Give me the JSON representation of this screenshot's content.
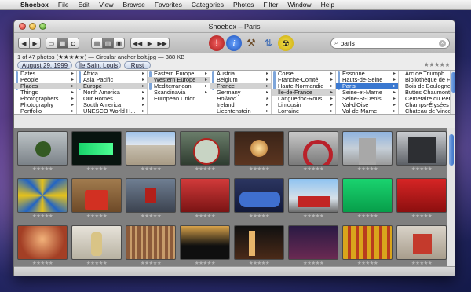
{
  "menubar": {
    "app": "Shoebox",
    "items": [
      "File",
      "Edit",
      "View",
      "Browse",
      "Favorites",
      "Categories",
      "Photos",
      "Filter",
      "Window",
      "Help"
    ]
  },
  "window": {
    "title": "Shoebox – Paris"
  },
  "search": {
    "value": "paris"
  },
  "info": {
    "text": "1 of 47 photos (★★★★★) — Circular anchor bolt.jpg — 388 KB",
    "rating": "★★★★★"
  },
  "tags": [
    "August 29, 1999",
    "Île Saint Louis",
    "Rust"
  ],
  "columns": [
    {
      "items": [
        "Dates",
        "People",
        "Places",
        "Things",
        "Photographers",
        "Photography",
        "Portfolio"
      ],
      "selected": 2
    },
    {
      "items": [
        "Africa",
        "Asia Pacific",
        "Europe",
        "North America",
        "Our Homes",
        "South America",
        "UNESCO World H..."
      ],
      "selected": 2
    },
    {
      "items": [
        "Eastern Europe",
        "Western Europe",
        "Mediterranean",
        "Scandinavia",
        "European Union"
      ],
      "selected": 1
    },
    {
      "items": [
        "Austria",
        "Belgium",
        "France",
        "Germany",
        "Holland",
        "Ireland",
        "Liechtenstein"
      ],
      "selected": 2
    },
    {
      "items": [
        "Corse",
        "Franche-Comté",
        "Haute-Normandie",
        "Île-de-France",
        "Languedoc-Rous...",
        "Limousin",
        "Lorraine"
      ],
      "selected": 3
    },
    {
      "items": [
        "Essonne",
        "Hauts-de-Seine",
        "Paris",
        "Seine-et-Marne",
        "Seine-St-Denis",
        "Val-d'Oise",
        "Val-de-Marne"
      ],
      "selected": 2
    },
    {
      "items": [
        "Arc de Triumph",
        "Bibliothèque de F...",
        "Bois de Boulogne",
        "Buttes Chaumont",
        "Cemetaire du Pere ...",
        "Champs-Élysées",
        "Chateau de Vincennes"
      ],
      "selected": -1
    }
  ],
  "thumb_rating": "★★★★★",
  "thumbnails_count": 24,
  "icons": [
    "apple-logo-icon",
    "back-icon",
    "forward-icon",
    "folder-icon",
    "filmstrip-icon",
    "camera-icon",
    "grid-view-icon",
    "list-view-icon",
    "detail-view-icon",
    "rewind-icon",
    "play-icon",
    "fast-forward-icon",
    "warning-icon",
    "info-icon",
    "hammer-icon",
    "sort-icon",
    "radiation-icon",
    "search-icon",
    "clear-icon"
  ]
}
